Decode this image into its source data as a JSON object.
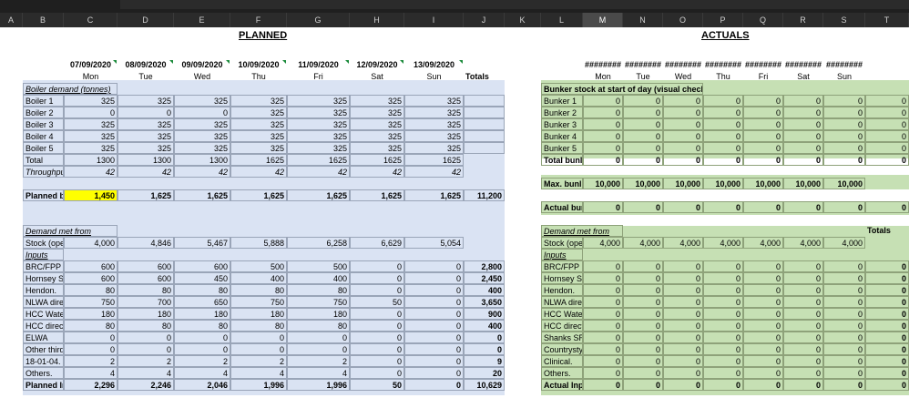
{
  "columns": [
    "A",
    "B",
    "C",
    "D",
    "E",
    "F",
    "G",
    "H",
    "I",
    "J",
    "K",
    "L",
    "M",
    "N",
    "O",
    "P",
    "Q",
    "R",
    "S",
    "T"
  ],
  "selected_column": "M",
  "planned": {
    "title": "PLANNED",
    "dates": [
      "07/09/2020",
      "08/09/2020",
      "09/09/2020",
      "10/09/2020",
      "11/09/2020",
      "12/09/2020",
      "13/09/2020"
    ],
    "days": [
      "Mon",
      "Tue",
      "Wed",
      "Thu",
      "Fri",
      "Sat",
      "Sun"
    ],
    "totals_label": "Totals",
    "boiler_header": "Boiler demand (tonnes)",
    "boilers": [
      {
        "label": "Boiler 1",
        "values": [
          "325",
          "325",
          "325",
          "325",
          "325",
          "325",
          "325"
        ]
      },
      {
        "label": "Boiler 2",
        "values": [
          "0",
          "0",
          "0",
          "325",
          "325",
          "325",
          "325"
        ]
      },
      {
        "label": "Boiler 3",
        "values": [
          "325",
          "325",
          "325",
          "325",
          "325",
          "325",
          "325"
        ]
      },
      {
        "label": "Boiler 4",
        "values": [
          "325",
          "325",
          "325",
          "325",
          "325",
          "325",
          "325"
        ]
      },
      {
        "label": "Boiler 5",
        "values": [
          "325",
          "325",
          "325",
          "325",
          "325",
          "325",
          "325"
        ]
      }
    ],
    "total_row": {
      "label": "Total",
      "values": [
        "1300",
        "1300",
        "1300",
        "1625",
        "1625",
        "1625",
        "1625"
      ]
    },
    "throughput_row": {
      "label": "Throughpu",
      "values": [
        "42",
        "42",
        "42",
        "42",
        "42",
        "42",
        "42"
      ]
    },
    "planned_b": {
      "label": "Planned b",
      "values": [
        "1,450",
        "1,625",
        "1,625",
        "1,625",
        "1,625",
        "1,625",
        "1,625"
      ],
      "total": "11,200"
    },
    "demand_header": "Demand met from",
    "stock_row": {
      "label": "Stock (ope",
      "values": [
        "4,000",
        "4,846",
        "5,467",
        "5,888",
        "6,258",
        "6,629",
        "5,054"
      ]
    },
    "inputs_label": "Inputs",
    "inputs": [
      {
        "label": "BRC/FPP",
        "values": [
          "600",
          "600",
          "600",
          "500",
          "500",
          "0",
          "0"
        ],
        "total": "2,800"
      },
      {
        "label": "Hornsey St",
        "values": [
          "600",
          "600",
          "450",
          "400",
          "400",
          "0",
          "0"
        ],
        "total": "2,450"
      },
      {
        "label": "Hendon.",
        "values": [
          "80",
          "80",
          "80",
          "80",
          "80",
          "0",
          "0"
        ],
        "total": "400"
      },
      {
        "label": "NLWA dire",
        "values": [
          "750",
          "700",
          "650",
          "750",
          "750",
          "50",
          "0"
        ],
        "total": "3,650"
      },
      {
        "label": "HCC Wate",
        "values": [
          "180",
          "180",
          "180",
          "180",
          "180",
          "0",
          "0"
        ],
        "total": "900"
      },
      {
        "label": "HCC direct",
        "values": [
          "80",
          "80",
          "80",
          "80",
          "80",
          "0",
          "0"
        ],
        "total": "400"
      },
      {
        "label": "ELWA",
        "values": [
          "0",
          "0",
          "0",
          "0",
          "0",
          "0",
          "0"
        ],
        "total": "0"
      },
      {
        "label": "Other third",
        "values": [
          "0",
          "0",
          "0",
          "0",
          "0",
          "0",
          "0"
        ],
        "total": "0"
      },
      {
        "label": "18-01-04.",
        "values": [
          "2",
          "2",
          "2",
          "2",
          "2",
          "0",
          "0"
        ],
        "total": "9"
      },
      {
        "label": "Others.",
        "values": [
          "4",
          "4",
          "4",
          "4",
          "4",
          "0",
          "0"
        ],
        "total": "20"
      }
    ],
    "planned_in": {
      "label": "Planned In",
      "values": [
        "2,296",
        "2,246",
        "2,046",
        "1,996",
        "1,996",
        "50",
        "0"
      ],
      "total": "10,629"
    }
  },
  "actuals": {
    "title": "ACTUALS",
    "dates": [
      "########",
      "########",
      "########",
      "########",
      "########",
      "########",
      "########"
    ],
    "days": [
      "Mon",
      "Tue",
      "Wed",
      "Thu",
      "Fri",
      "Sat",
      "Sun"
    ],
    "bunker_header": "Bunker stock at start of day (visual check)",
    "bunkers": [
      {
        "label": "Bunker 1",
        "values": [
          "0",
          "0",
          "0",
          "0",
          "0",
          "0",
          "0",
          "0"
        ]
      },
      {
        "label": "Bunker 2",
        "values": [
          "0",
          "0",
          "0",
          "0",
          "0",
          "0",
          "0",
          "0"
        ]
      },
      {
        "label": "Bunker 3",
        "values": [
          "0",
          "0",
          "0",
          "0",
          "0",
          "0",
          "0",
          "0"
        ]
      },
      {
        "label": "Bunker 4",
        "values": [
          "0",
          "0",
          "0",
          "0",
          "0",
          "0",
          "0",
          "0"
        ]
      },
      {
        "label": "Bunker 5",
        "values": [
          "0",
          "0",
          "0",
          "0",
          "0",
          "0",
          "0",
          "0"
        ]
      }
    ],
    "total_bunker": {
      "label": "Total bunl",
      "values": [
        "0",
        "0",
        "0",
        "0",
        "0",
        "0",
        "0",
        "0"
      ]
    },
    "max_bunker": {
      "label": "Max. bunl",
      "values": [
        "10,000",
        "10,000",
        "10,000",
        "10,000",
        "10,000",
        "10,000",
        "10,000"
      ]
    },
    "actual_bur": {
      "label": "Actual bur",
      "values": [
        "0",
        "0",
        "0",
        "0",
        "0",
        "0",
        "0",
        "0"
      ]
    },
    "demand_header": "Demand met from",
    "totals_label": "Totals",
    "stock_row": {
      "label": "Stock (ope",
      "values": [
        "4,000",
        "4,000",
        "4,000",
        "4,000",
        "4,000",
        "4,000",
        "4,000"
      ]
    },
    "inputs_label": "Inputs",
    "inputs": [
      {
        "label": "BRC/FPP",
        "values": [
          "0",
          "0",
          "0",
          "0",
          "0",
          "0",
          "0"
        ],
        "total": "0"
      },
      {
        "label": "Hornsey St",
        "values": [
          "0",
          "0",
          "0",
          "0",
          "0",
          "0",
          "0"
        ],
        "total": "0"
      },
      {
        "label": "Hendon.",
        "values": [
          "0",
          "0",
          "0",
          "0",
          "0",
          "0",
          "0"
        ],
        "total": "0"
      },
      {
        "label": "NLWA dire",
        "values": [
          "0",
          "0",
          "0",
          "0",
          "0",
          "0",
          "0"
        ],
        "total": "0"
      },
      {
        "label": "HCC Wate",
        "values": [
          "0",
          "0",
          "0",
          "0",
          "0",
          "0",
          "0"
        ],
        "total": "0"
      },
      {
        "label": "HCC direct",
        "values": [
          "0",
          "0",
          "0",
          "0",
          "0",
          "0",
          "0"
        ],
        "total": "0"
      },
      {
        "label": "Shanks SRI",
        "values": [
          "0",
          "0",
          "0",
          "0",
          "0",
          "0",
          "0"
        ],
        "total": "0"
      },
      {
        "label": "Countrysty",
        "values": [
          "0",
          "0",
          "0",
          "0",
          "0",
          "0",
          "0"
        ],
        "total": "0"
      },
      {
        "label": "Clinical.",
        "values": [
          "0",
          "0",
          "0",
          "0",
          "0",
          "0",
          "0"
        ],
        "total": "0"
      },
      {
        "label": "Others.",
        "values": [
          "0",
          "0",
          "0",
          "0",
          "0",
          "0",
          "0"
        ],
        "total": "0"
      }
    ],
    "actual_inp": {
      "label": "Actual Inp",
      "values": [
        "0",
        "0",
        "0",
        "0",
        "0",
        "0",
        "0"
      ],
      "total": "0"
    }
  },
  "colors": {
    "planned_fill": "#dae3f3",
    "actuals_fill": "#c6e0b4",
    "highlight": "#ffff00",
    "header_bg": "#2b2b2b"
  }
}
